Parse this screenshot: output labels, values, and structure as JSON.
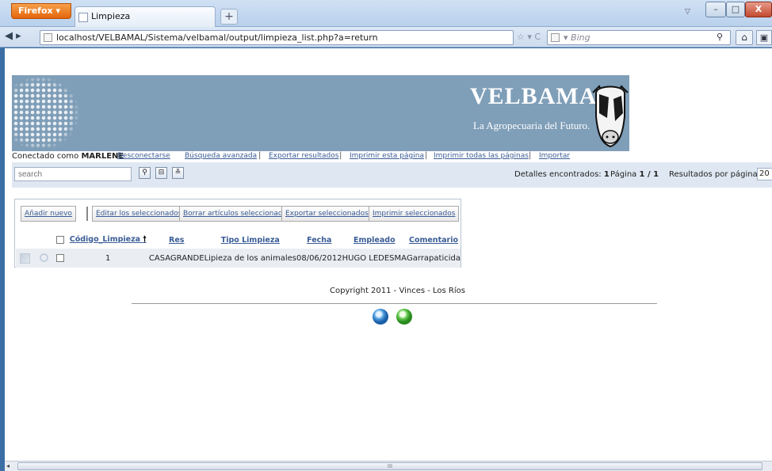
{
  "browser": {
    "app_button": "Firefox",
    "tab_title": "Limpieza",
    "url": "localhost/VELBAMAL/Sistema/velbamal/output/limpieza_list.php?a=return",
    "search_engine": "Bing"
  },
  "header": {
    "brand": "VELBAMAL",
    "tagline": "La Agropecuaria del Futuro."
  },
  "links": {
    "connected_as": "Conectado como",
    "username": "MARLENE",
    "logout": "Desconectarse",
    "advanced_search": "Búsqueda avanzada",
    "export_results": "Exportar resultados",
    "print_page": "Imprimir esta página",
    "print_all": "Imprimir todas las páginas",
    "import": "Importar",
    "separator": "|"
  },
  "toolbar": {
    "search_placeholder": "search",
    "details_label": "Detalles encontrados:",
    "details_count": "1",
    "page_label": "Página",
    "page_value": "1 / 1",
    "rpp_label": "Resultados por página:",
    "rpp_value": "20"
  },
  "actions": {
    "add_new": "Añadir nuevo",
    "edit_selected": "Editar los seleccionados",
    "delete_selected": "Borrar artículos seleccionados",
    "export_selected": "Exportar seleccionados",
    "print_selected": "Imprimir seleccionados"
  },
  "table": {
    "columns": [
      "Código_Limpieza",
      "Res",
      "Tipo Limpieza",
      "Fecha",
      "Empleado",
      "Comentario"
    ],
    "rows": [
      {
        "codigo": "1",
        "res": "CASAGRANDE",
        "tipo": "Lipieza de los animales",
        "fecha": "08/06/2012",
        "empleado": "HUGO LEDESMA",
        "comentario": "Garrapaticida"
      }
    ]
  },
  "footer": {
    "copyright": "Copyright 2011 - Vinces - Los Ríos"
  }
}
